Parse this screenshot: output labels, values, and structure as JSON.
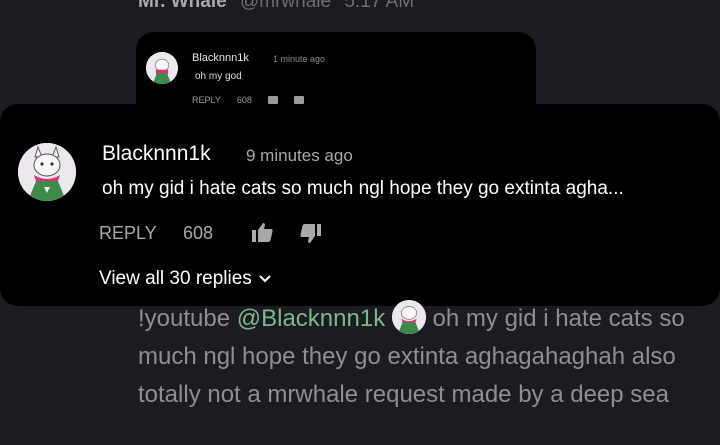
{
  "background_chat": {
    "author": "Mr. Whale",
    "handle": "@mrwhale",
    "time": "5:17 AM",
    "embedded_card": {
      "name": "Blacknnn1k",
      "time_ago": "1 minute ago",
      "text": "oh my god",
      "reply_label": "REPLY",
      "likes": "608"
    },
    "message": {
      "prefix": "!youtube ",
      "mention": "@Blacknnn1k",
      "text": " oh my gid i hate cats so much ngl hope they go extinta aghagahaghah also totally not a mrwhale request made by a deep sea"
    }
  },
  "comment": {
    "author": "Blacknnn1k",
    "time_ago": "9 minutes ago",
    "text": "oh my gid i hate cats so much ngl hope they go extinta agha...",
    "reply_label": "REPLY",
    "likes": "608",
    "view_replies": "View all 30 replies"
  },
  "colors": {
    "background": "#1c1b22",
    "popup": "#000000",
    "mention": "#7eb88a"
  }
}
